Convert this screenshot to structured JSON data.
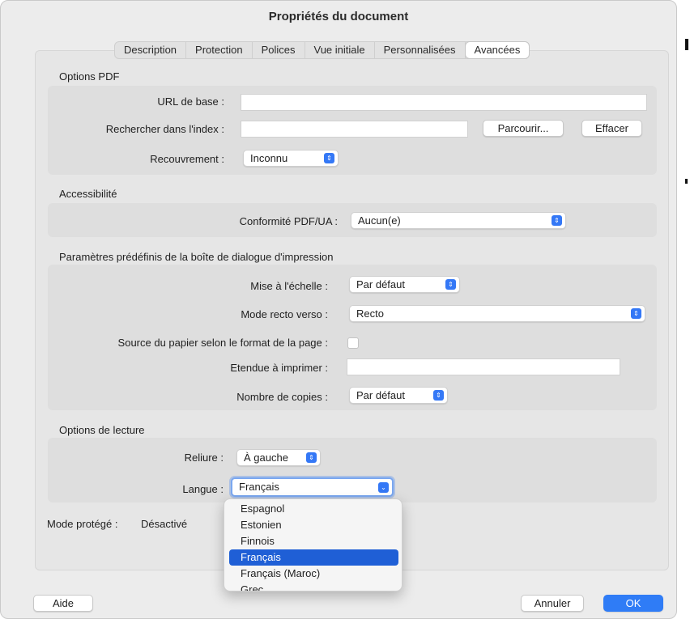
{
  "window": {
    "title": "Propriétés du document"
  },
  "tabs": [
    {
      "label": "Description"
    },
    {
      "label": "Protection"
    },
    {
      "label": "Polices"
    },
    {
      "label": "Vue initiale"
    },
    {
      "label": "Personnalisées"
    },
    {
      "label": "Avancées",
      "active": true
    }
  ],
  "pdf_options": {
    "section_label": "Options PDF",
    "base_url_label": "URL de base :",
    "base_url_value": "",
    "index_label": "Rechercher dans l'index :",
    "index_value": "",
    "browse_button": "Parcourir...",
    "clear_button": "Effacer",
    "trapping_label": "Recouvrement :",
    "trapping_value": "Inconnu"
  },
  "accessibility": {
    "section_label": "Accessibilité",
    "pdfua_label": "Conformité PDF/UA :",
    "pdfua_value": "Aucun(e)"
  },
  "print_presets": {
    "section_label": "Paramètres prédéfinis de la boîte de dialogue d'impression",
    "scaling_label": "Mise à l'échelle :",
    "scaling_value": "Par défaut",
    "duplex_label": "Mode recto verso :",
    "duplex_value": "Recto",
    "paper_source_label": "Source du papier selon le format de la page :",
    "paper_source_checked": false,
    "range_label": "Etendue à imprimer :",
    "range_value": "",
    "copies_label": "Nombre de copies :",
    "copies_value": "Par défaut"
  },
  "reading_options": {
    "section_label": "Options de lecture",
    "binding_label": "Reliure :",
    "binding_value": "À gauche",
    "language_label": "Langue :",
    "language_value": "Français"
  },
  "protected_mode": {
    "label": "Mode protégé :",
    "value": "Désactivé"
  },
  "language_dropdown": {
    "options": [
      "Espagnol",
      "Estonien",
      "Finnois",
      "Français",
      "Français (Maroc)",
      "Grec"
    ],
    "selected_index": 3
  },
  "footer": {
    "help_button": "Aide",
    "cancel_button": "Annuler",
    "ok_button": "OK"
  },
  "colors": {
    "accent": "#3478f6",
    "selection": "#1f5fd6",
    "window_bg": "#ececec"
  },
  "icons": {
    "popup_arrow": "updown-chevron-icon",
    "dropdown_arrow": "chevron-down-icon"
  }
}
